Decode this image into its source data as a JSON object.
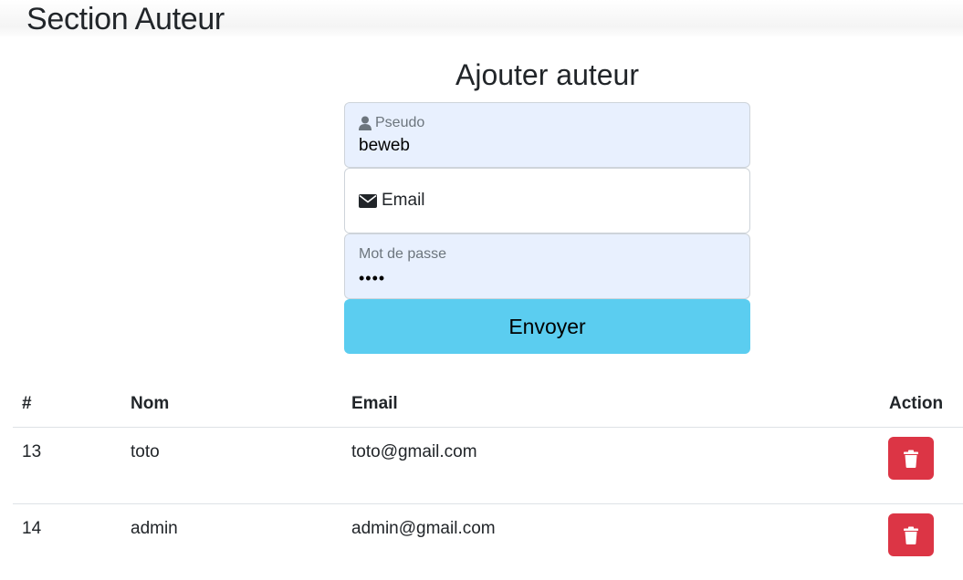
{
  "header": {
    "title": "Section Auteur"
  },
  "form": {
    "title": "Ajouter auteur",
    "pseudo": {
      "label": "Pseudo",
      "value": "beweb",
      "icon": "user-icon"
    },
    "email": {
      "label": "Email",
      "value": "",
      "icon": "envelope-icon"
    },
    "password": {
      "label": "Mot de passe",
      "value": "••••"
    },
    "submit_label": "Envoyer"
  },
  "table": {
    "headers": [
      "#",
      "Nom",
      "Email",
      "Action"
    ],
    "rows": [
      {
        "id": "13",
        "nom": "toto",
        "email": "toto@gmail.com"
      },
      {
        "id": "14",
        "nom": "admin",
        "email": "admin@gmail.com"
      }
    ],
    "delete_icon": "trash-icon"
  },
  "colors": {
    "submit": "#5bcdf0",
    "delete": "#dc3545",
    "autofill": "#e8f0fe"
  }
}
